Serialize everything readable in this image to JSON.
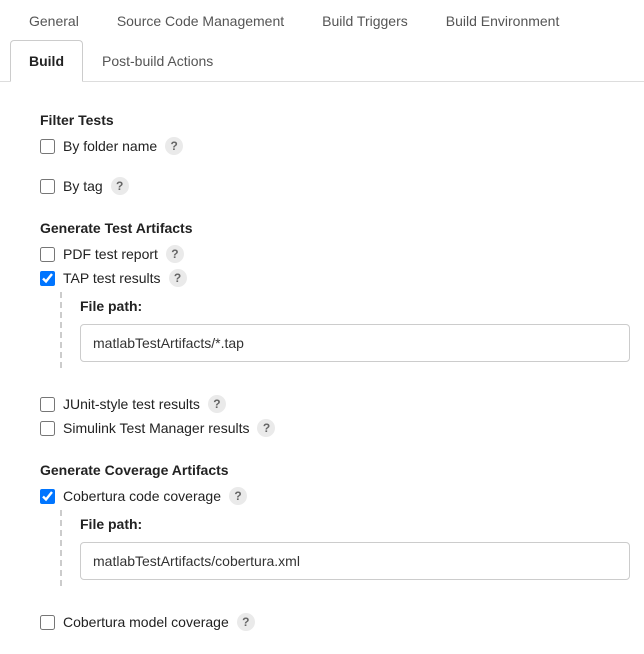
{
  "tabs": {
    "general": "General",
    "scm": "Source Code Management",
    "triggers": "Build Triggers",
    "env": "Build Environment",
    "build": "Build",
    "post": "Post-build Actions"
  },
  "sections": {
    "filter_tests": {
      "heading": "Filter Tests",
      "by_folder": "By folder name",
      "by_tag": "By tag"
    },
    "gen_test": {
      "heading": "Generate Test Artifacts",
      "pdf": "PDF test report",
      "tap": "TAP test results",
      "tap_path_label": "File path:",
      "tap_path_value": "matlabTestArtifacts/*.tap",
      "junit": "JUnit-style test results",
      "simulink": "Simulink Test Manager results"
    },
    "gen_cov": {
      "heading": "Generate Coverage Artifacts",
      "cobertura_code": "Cobertura code coverage",
      "cobertura_path_label": "File path:",
      "cobertura_path_value": "matlabTestArtifacts/cobertura.xml",
      "cobertura_model": "Cobertura model coverage"
    }
  },
  "help": "?"
}
